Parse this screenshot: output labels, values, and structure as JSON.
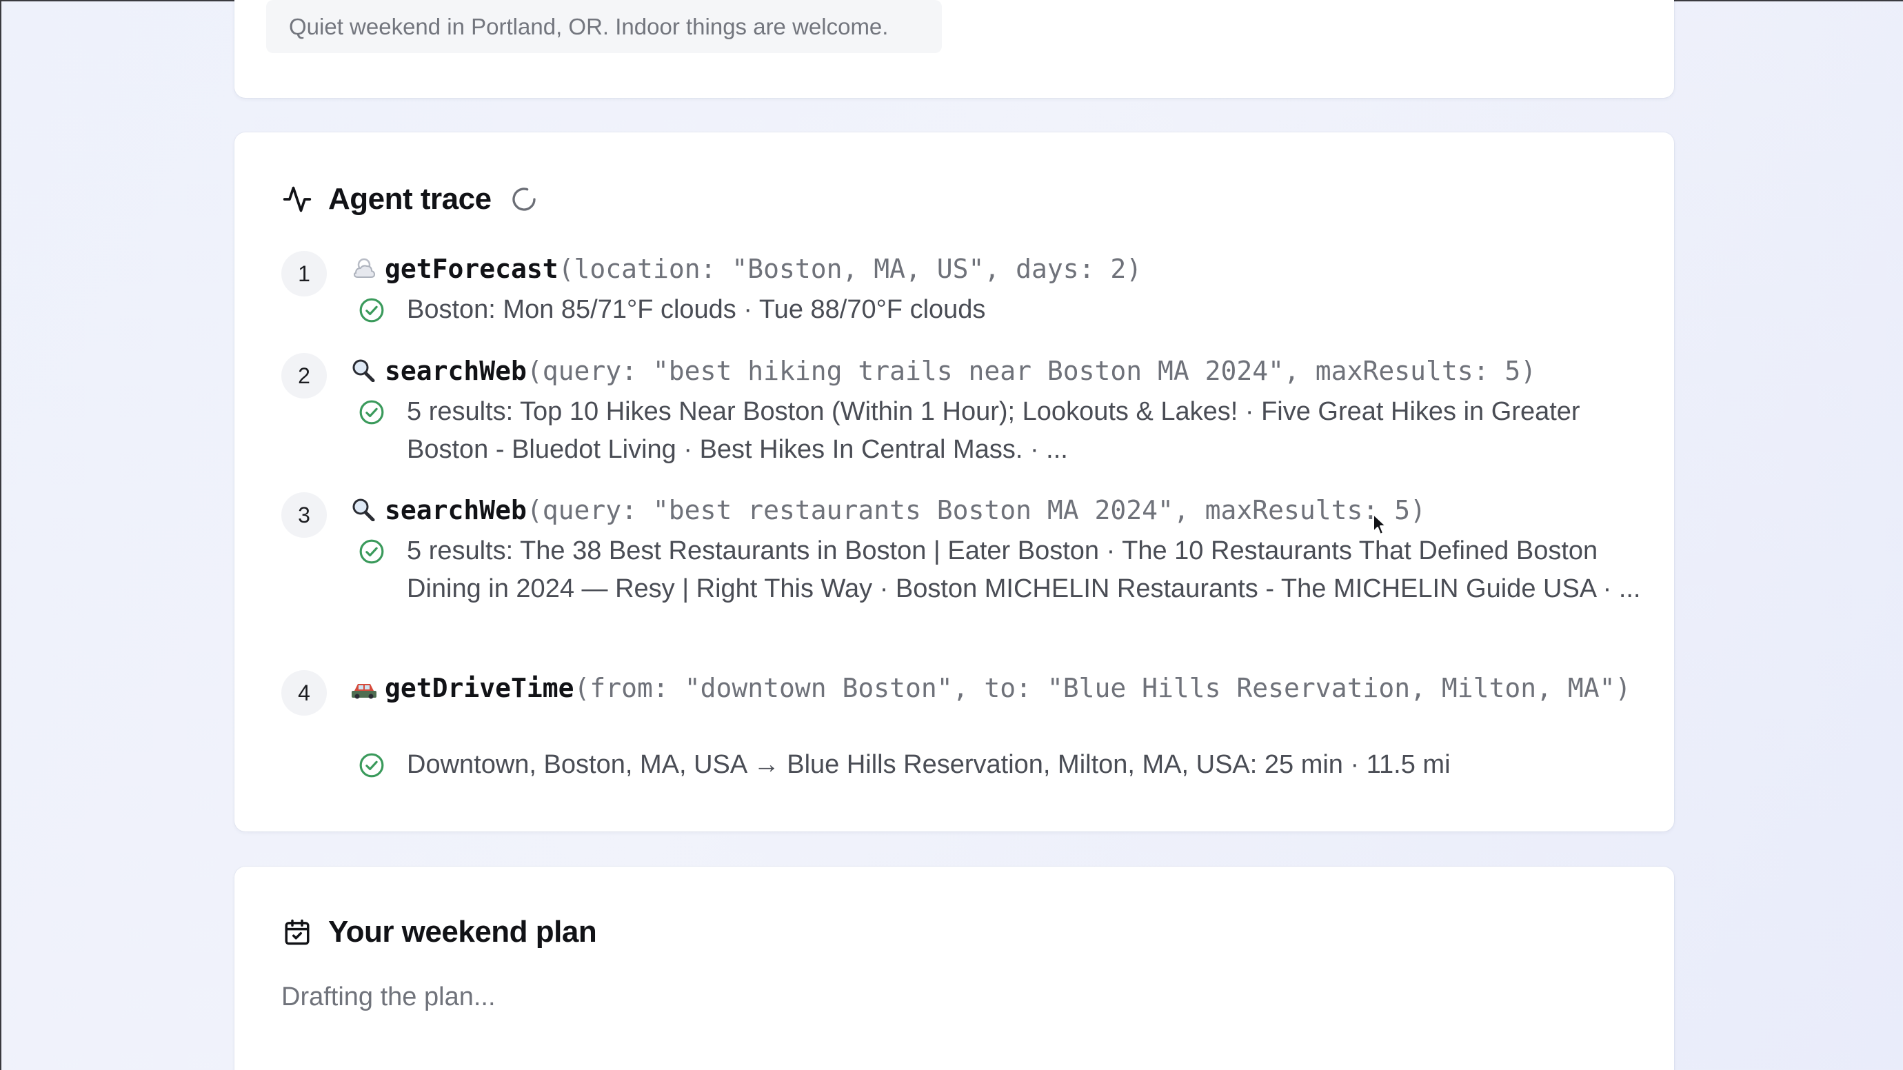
{
  "request": {
    "text": "Quiet weekend in Portland, OR. Indoor things are welcome."
  },
  "trace": {
    "title": "Agent trace",
    "icon": "activity-icon",
    "status_icon": "loading-spinner-icon",
    "steps": [
      {
        "number": "1",
        "icon": "weather-icon",
        "fn": "getForecast",
        "args": "(location: \"Boston, MA, US\", days: 2)",
        "result": "Boston: Mon 85/71°F clouds · Tue 88/70°F clouds"
      },
      {
        "number": "2",
        "icon": "search-icon",
        "fn": "searchWeb",
        "args": "(query: \"best hiking trails near Boston MA 2024\", maxResults: 5)",
        "result": "5 results: Top 10 Hikes Near Boston (Within 1 Hour); Lookouts & Lakes! · Five Great Hikes in Greater Boston - Bluedot Living · Best Hikes In Central Mass. · ..."
      },
      {
        "number": "3",
        "icon": "search-icon",
        "fn": "searchWeb",
        "args": "(query: \"best restaurants Boston MA 2024\", maxResults: 5)",
        "result": "5 results: The 38 Best Restaurants in Boston | Eater Boston · The 10 Restaurants That Defined Boston Dining in 2024 — Resy | Right This Way · Boston MICHELIN Restaurants - The MICHELIN Guide USA · ..."
      },
      {
        "number": "4",
        "icon": "car-icon",
        "fn": "getDriveTime",
        "args": "(from: \"downtown Boston\", to: \"Blue Hills Reservation, Milton, MA\")",
        "result": "Downtown, Boston, MA, USA → Blue Hills Reservation, Milton, MA, USA: 25 min · 11.5 mi"
      }
    ]
  },
  "plan": {
    "title": "Your weekend plan",
    "icon": "calendar-check-icon",
    "status": "Drafting the plan..."
  },
  "colors": {
    "success": "#3a9a5b",
    "background": "#eef1fb",
    "card": "#ffffff"
  }
}
